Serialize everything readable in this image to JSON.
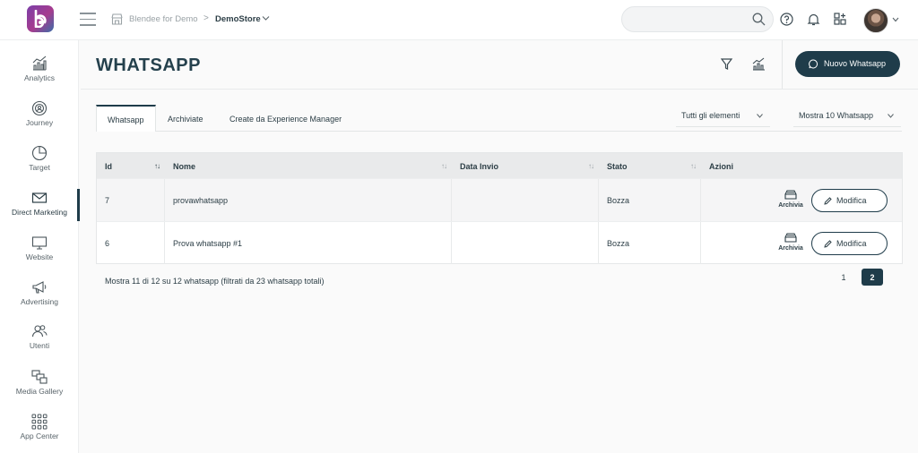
{
  "breadcrumb": {
    "workspace": "Blendee for Demo",
    "separator": ">",
    "store": "DemoStore"
  },
  "search": {
    "placeholder": ""
  },
  "sidebar": {
    "items": [
      {
        "label": "Analytics",
        "icon": "analytics-icon"
      },
      {
        "label": "Journey",
        "icon": "journey-icon"
      },
      {
        "label": "Target",
        "icon": "target-icon"
      },
      {
        "label": "Direct Marketing",
        "icon": "mail-icon",
        "active": true
      },
      {
        "label": "Website",
        "icon": "monitor-icon"
      },
      {
        "label": "Advertising",
        "icon": "megaphone-icon"
      },
      {
        "label": "Utenti",
        "icon": "users-icon"
      },
      {
        "label": "Media Gallery",
        "icon": "media-gallery-icon"
      },
      {
        "label": "App Center",
        "icon": "grid-icon"
      }
    ]
  },
  "header": {
    "title": "WHATSAPP",
    "new_button": "Nuovo Whatsapp"
  },
  "tabs": [
    {
      "label": "Whatsapp",
      "active": true
    },
    {
      "label": "Archiviate"
    },
    {
      "label": "Create da Experience Manager"
    }
  ],
  "filters": {
    "items_filter": "Tutti gli elementi",
    "page_size": "Mostra 10 Whatsapp"
  },
  "table": {
    "columns": [
      "Id",
      "Nome",
      "Data Invio",
      "Stato",
      "Azioni"
    ],
    "sort_symbol": "↑↓",
    "rows": [
      {
        "id": "7",
        "name": "provawhatsapp",
        "date": "",
        "status": "Bozza",
        "archive_label": "Archivia",
        "edit_label": "Modifica"
      },
      {
        "id": "6",
        "name": "Prova whatsapp #1",
        "date": "",
        "status": "Bozza",
        "archive_label": "Archivia",
        "edit_label": "Modifica"
      }
    ]
  },
  "footer": {
    "info": "Mostra 11 di 12 su 12 whatsapp (filtrati da 23 whatsapp totali)"
  },
  "pagination": {
    "pages": [
      "1",
      "2"
    ],
    "current": "2"
  },
  "colors": {
    "primary": "#1f3c4a",
    "logo_gradient_start": "#7b3fa8",
    "logo_gradient_end": "#3b6ea8"
  }
}
